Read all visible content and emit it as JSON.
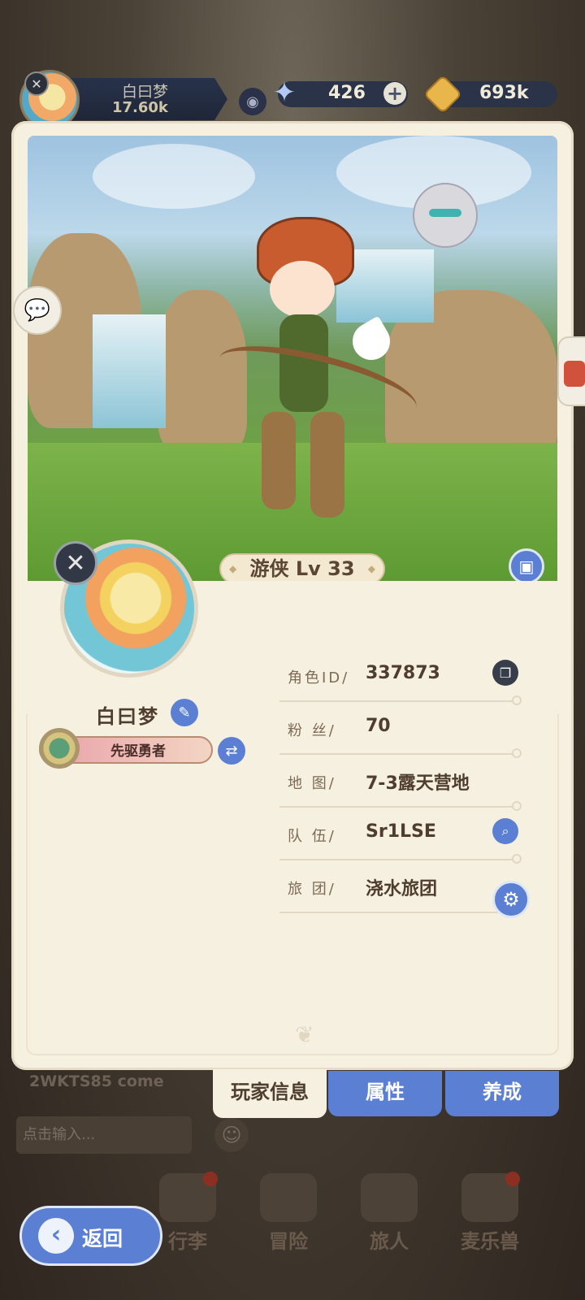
{
  "topbar": {
    "player_name": "白曰梦",
    "power": "17.60k",
    "gems": "426",
    "gold": "693k"
  },
  "scene": {
    "class_level": "游侠 Lv 33"
  },
  "profile": {
    "name": "白曰梦",
    "title": "先驱勇者"
  },
  "info": [
    {
      "label": "角色ID/",
      "value": "337873",
      "action_icon": "copy-icon"
    },
    {
      "label": "粉  丝/",
      "value": "70"
    },
    {
      "label": "地  图/",
      "value": "7-3露天营地"
    },
    {
      "label": "队  伍/",
      "value": "Sr1LSE",
      "action_icon": "search-icon"
    },
    {
      "label": "旅  团/",
      "value": "浇水旅团"
    }
  ],
  "tabs": [
    "玩家信息",
    "属性",
    "养成"
  ],
  "chat": {
    "last_message": "2WKTS85 come",
    "input_placeholder": "点击输入..."
  },
  "nav": [
    "行李",
    "冒险",
    "旅人",
    "麦乐兽"
  ],
  "back_label": "返回",
  "colors": {
    "accent_blue": "#5b7fd3",
    "card_bg": "#f6f0e1",
    "text_brown": "#4f3e2f"
  }
}
